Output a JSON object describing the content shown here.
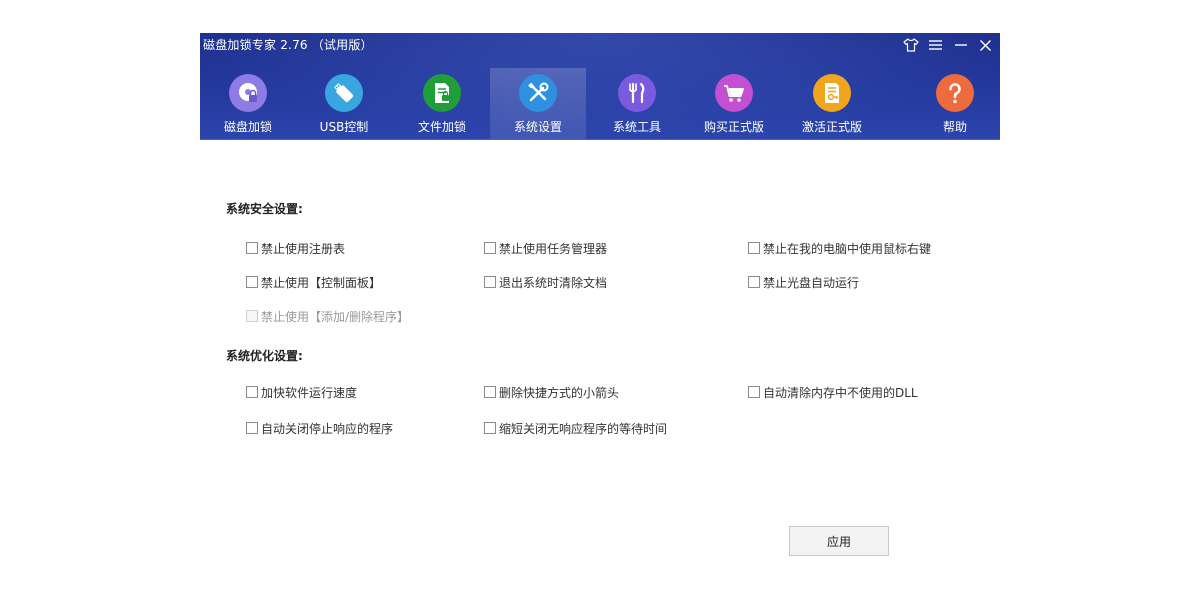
{
  "window": {
    "title": "磁盘加锁专家 2.76 （试用版）"
  },
  "window_controls": [
    {
      "name": "skin-icon"
    },
    {
      "name": "menu-icon"
    },
    {
      "name": "minimize-icon"
    },
    {
      "name": "close-icon"
    }
  ],
  "tabs": [
    {
      "label": "磁盘加锁",
      "icon": "disk-lock-icon",
      "color": "#8e7be6",
      "active": false
    },
    {
      "label": "USB控制",
      "icon": "usb-drive-icon",
      "color": "#3aa6df",
      "active": false
    },
    {
      "label": "文件加锁",
      "icon": "file-lock-icon",
      "color": "#1f9e3a",
      "active": false
    },
    {
      "label": "系统设置",
      "icon": "tools-icon",
      "color": "#2f8fe0",
      "active": true
    },
    {
      "label": "系统工具",
      "icon": "utensils-icon",
      "color": "#7a5be0",
      "active": false
    },
    {
      "label": "购买正式版",
      "icon": "cart-icon",
      "color": "#c34fd3",
      "active": false
    },
    {
      "label": "激活正式版",
      "icon": "key-document-icon",
      "color": "#f0a51e",
      "active": false
    },
    {
      "label": "帮助",
      "icon": "help-icon",
      "color": "#ef6a3c",
      "active": false
    }
  ],
  "security": {
    "title": "系统安全设置:",
    "options": [
      {
        "label": "禁止使用注册表",
        "checked": false,
        "disabled": false
      },
      {
        "label": "禁止使用任务管理器",
        "checked": false,
        "disabled": false
      },
      {
        "label": "禁止在我的电脑中使用鼠标右键",
        "checked": false,
        "disabled": false
      },
      {
        "label": "禁止使用【控制面板】",
        "checked": false,
        "disabled": false
      },
      {
        "label": "退出系统时清除文档",
        "checked": false,
        "disabled": false
      },
      {
        "label": "禁止光盘自动运行",
        "checked": false,
        "disabled": false
      },
      {
        "label": "禁止使用【添加/删除程序】",
        "checked": false,
        "disabled": true
      }
    ]
  },
  "optimization": {
    "title": "系统优化设置:",
    "options": [
      {
        "label": "加快软件运行速度",
        "checked": false,
        "disabled": false
      },
      {
        "label": "删除快捷方式的小箭头",
        "checked": false,
        "disabled": false
      },
      {
        "label": "自动清除内存中不使用的DLL",
        "checked": false,
        "disabled": false
      },
      {
        "label": "自动关闭停止响应的程序",
        "checked": false,
        "disabled": false
      },
      {
        "label": "缩短关闭无响应程序的等待时间",
        "checked": false,
        "disabled": false
      }
    ]
  },
  "apply_button": {
    "label": "应用"
  },
  "colors": {
    "header_top": "#1d2f8c",
    "header_bottom": "#2c45ad",
    "accent_line": "#3f63d1"
  }
}
